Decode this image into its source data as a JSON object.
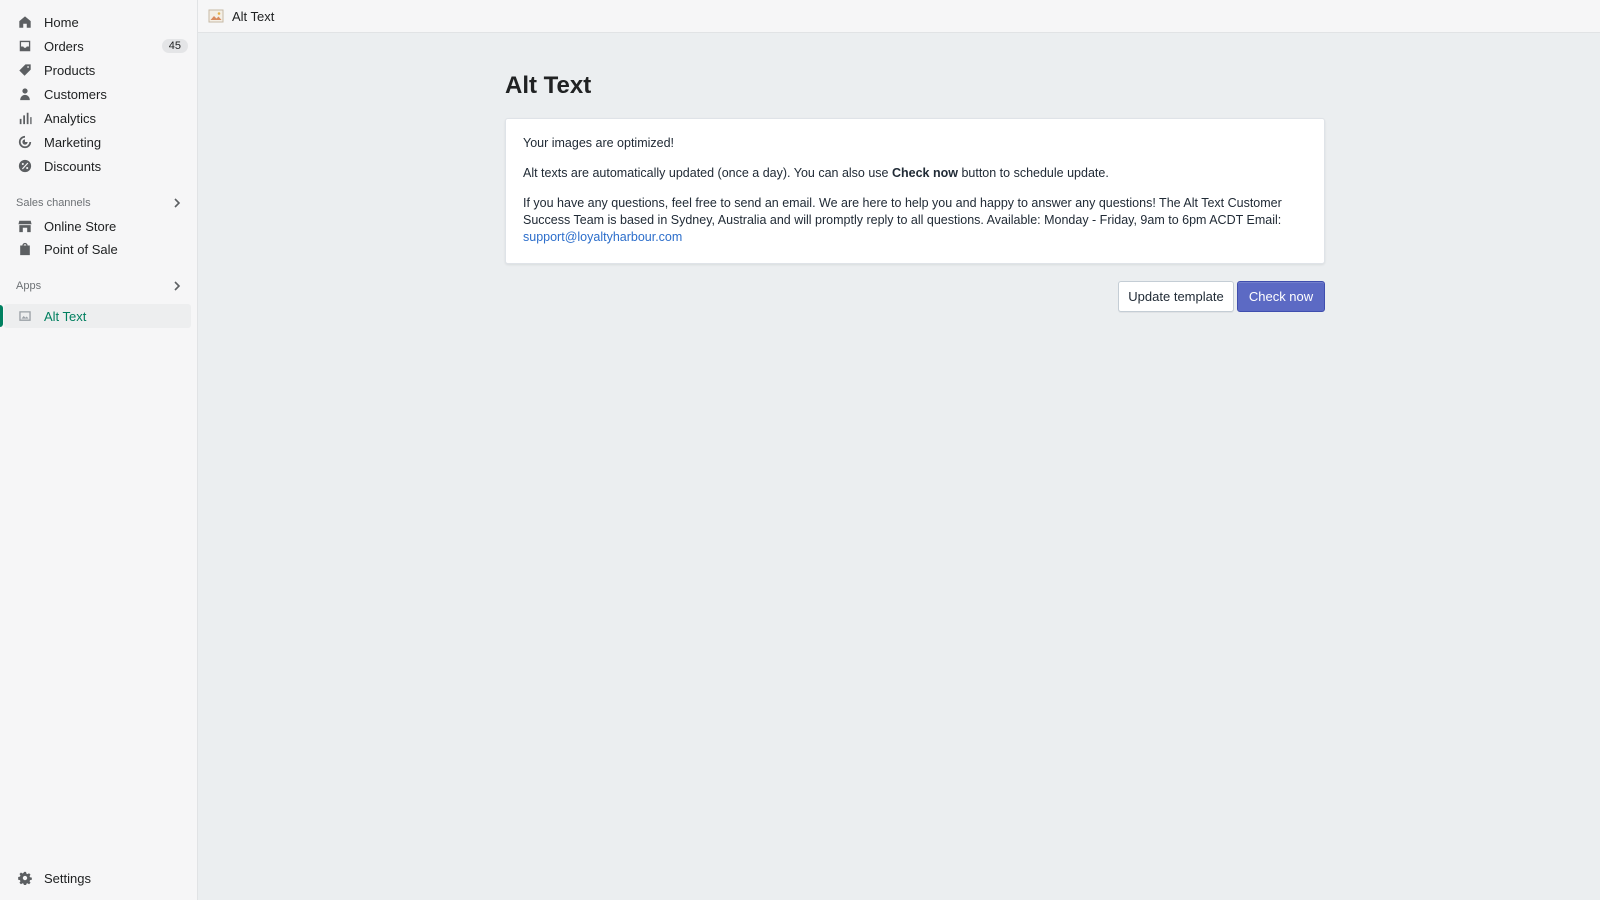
{
  "colors": {
    "accent": "#008060",
    "primary_button": "#5c6ac4",
    "link": "#2c6ecb"
  },
  "sidebar": {
    "items": [
      {
        "label": "Home",
        "icon": "home-icon"
      },
      {
        "label": "Orders",
        "icon": "orders-icon",
        "badge": "45"
      },
      {
        "label": "Products",
        "icon": "tag-icon"
      },
      {
        "label": "Customers",
        "icon": "person-icon"
      },
      {
        "label": "Analytics",
        "icon": "bar-chart-icon"
      },
      {
        "label": "Marketing",
        "icon": "target-icon"
      },
      {
        "label": "Discounts",
        "icon": "discount-icon"
      }
    ],
    "sales_channels": {
      "heading": "Sales channels",
      "items": [
        {
          "label": "Online Store",
          "icon": "store-icon"
        },
        {
          "label": "Point of Sale",
          "icon": "bag-icon"
        }
      ]
    },
    "apps": {
      "heading": "Apps",
      "items": [
        {
          "label": "Alt Text",
          "icon": "app-image-icon",
          "active": true
        }
      ]
    },
    "settings": {
      "label": "Settings",
      "icon": "gear-icon"
    }
  },
  "topbar": {
    "title": "Alt Text"
  },
  "main": {
    "title": "Alt Text",
    "card": {
      "line1": "Your images are optimized!",
      "line2_before": "Alt texts are automatically updated (once a day). You can also use ",
      "line2_strong": "Check now",
      "line2_after": " button to schedule update.",
      "line3": "If you have any questions, feel free to send an email. We are here to help you and happy to answer any questions! The Alt Text Customer Success Team is based in Sydney, Australia and will promptly reply to all questions. Available: Monday - Friday, 9am to 6pm ACDT Email:",
      "email": "support@loyaltyharbour.com"
    },
    "buttons": {
      "update_template": "Update template",
      "check_now": "Check now"
    }
  }
}
